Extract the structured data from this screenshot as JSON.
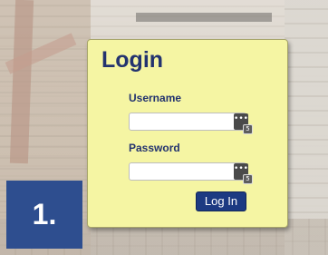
{
  "login": {
    "title": "Login",
    "username_label": "Username",
    "username_value": "",
    "password_label": "Password",
    "password_value": "",
    "button_label": "Log In",
    "field_icon_badge": "5"
  },
  "step": {
    "label": "1."
  },
  "colors": {
    "panel_bg": "#f5f5a3",
    "title_text": "#23336f",
    "button_bg": "#1c3a82",
    "step_badge_bg": "#2e4e8f"
  },
  "icons": {
    "field_icon": "password-manager-icon"
  }
}
